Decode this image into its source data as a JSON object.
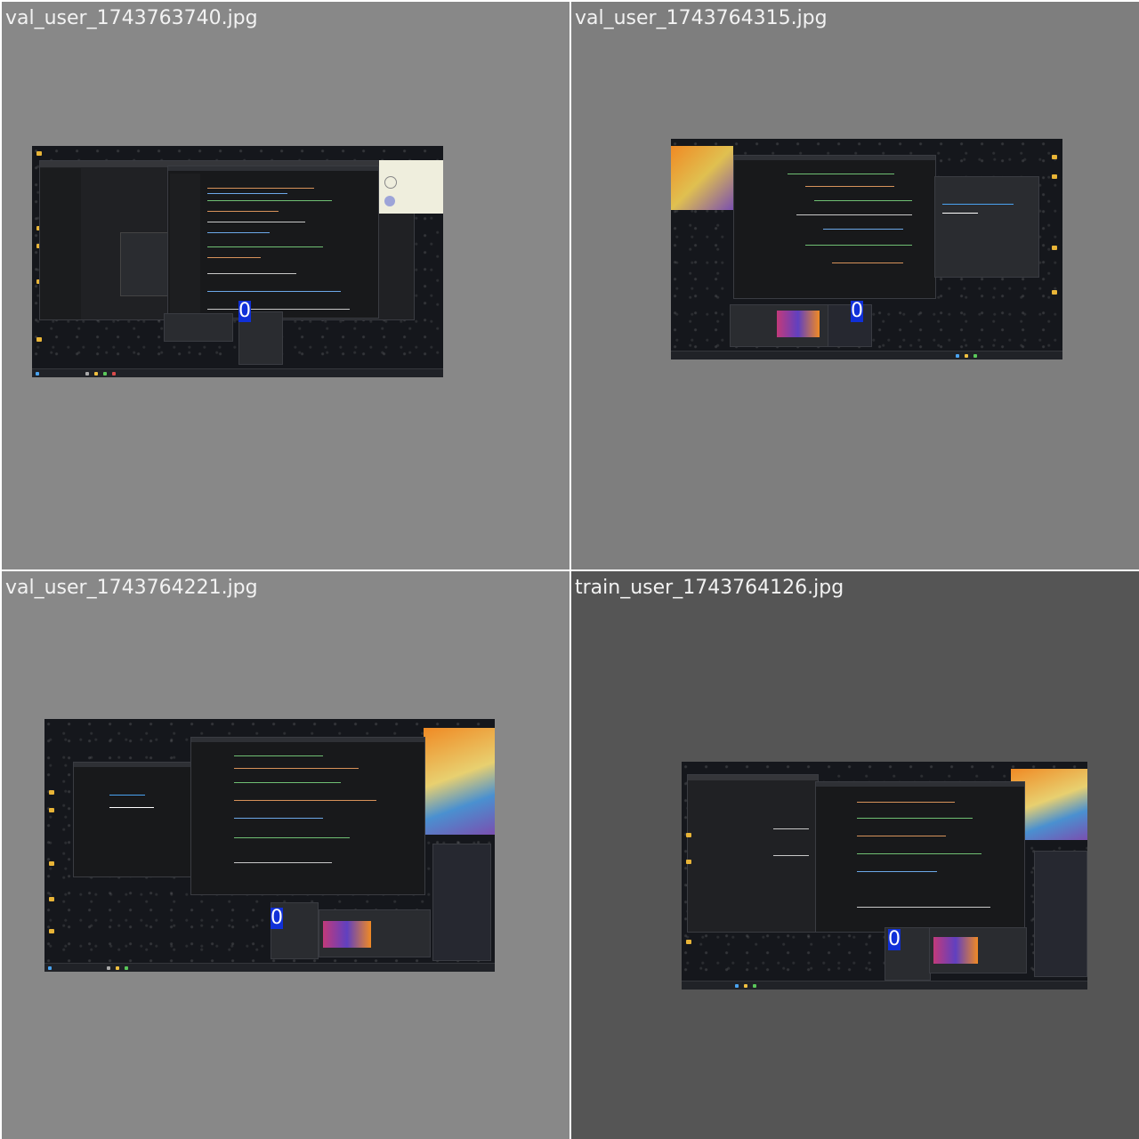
{
  "tiles": [
    {
      "filename": "val_user_1743763740.jpg",
      "label": "0"
    },
    {
      "filename": "val_user_1743764315.jpg",
      "label": "0"
    },
    {
      "filename": "val_user_1743764221.jpg",
      "label": "0"
    },
    {
      "filename": "train_user_1743764126.jpg",
      "label": "0"
    }
  ],
  "colors": {
    "tile_bg_light": "#888888",
    "tile_bg_mid": "#7e7e7e",
    "tile_bg_dark": "#555555",
    "grid_line": "#ffffff",
    "label_text": "#f2f2f2",
    "badge_bg": "#1030d8",
    "badge_text": "#ffffff",
    "desktop_bg": "#15171c",
    "window_bg": "#1f2023",
    "code_green": "#6fbf73",
    "code_orange": "#d7925a",
    "code_blue": "#6ca8e8",
    "folder_icon": "#e8b437",
    "accent_orange": "#f08a24"
  },
  "icons": [
    "folder-icon",
    "code-window-icon",
    "taskbar-icon",
    "artwork-icon"
  ]
}
